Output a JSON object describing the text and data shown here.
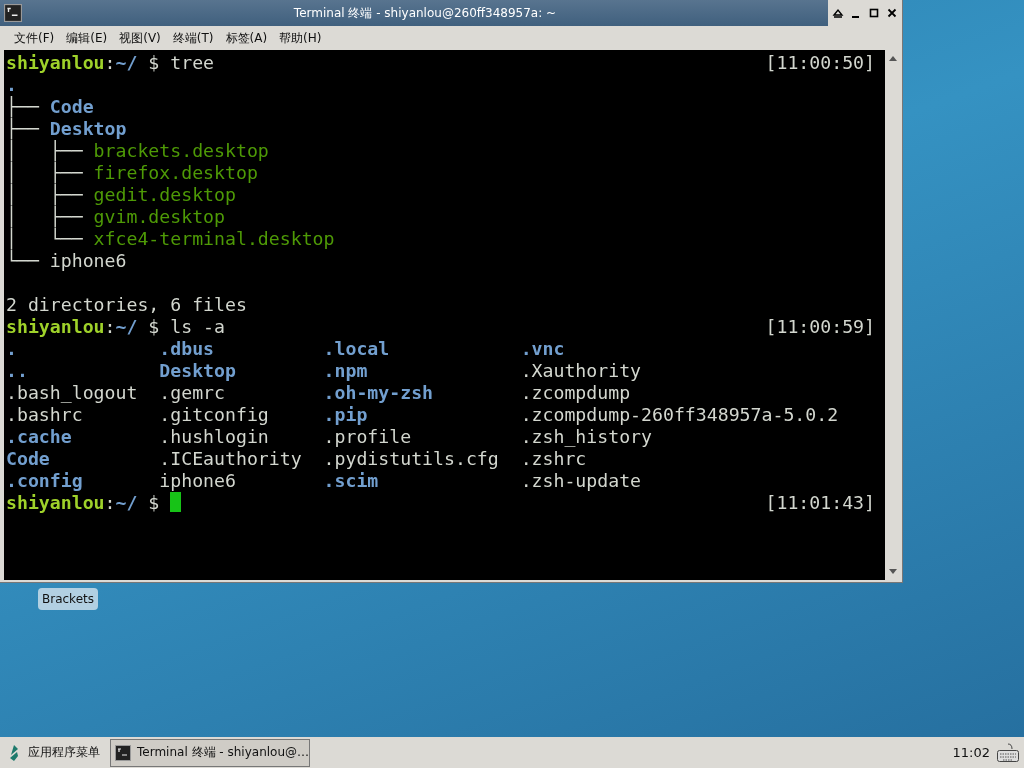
{
  "window": {
    "title": "Terminal 终端 - shiyanlou@260ff348957a: ~"
  },
  "menu": [
    "文件(F)",
    "编辑(E)",
    "视图(V)",
    "终端(T)",
    "标签(A)",
    "帮助(H)"
  ],
  "terminal": {
    "blocks": [
      {
        "kind": "line",
        "segments": [
          {
            "kind": "user",
            "text": "shiyanlou"
          },
          {
            "kind": "plain",
            "text": ":"
          },
          {
            "kind": "path",
            "text": "~/"
          },
          {
            "kind": "plain",
            "text": " $ tree"
          }
        ],
        "timestamp": "[11:00:50]"
      },
      {
        "kind": "line",
        "segments": [
          {
            "kind": "dir",
            "text": "."
          }
        ]
      },
      {
        "kind": "line",
        "segments": [
          {
            "kind": "plain",
            "text": "├── "
          },
          {
            "kind": "dir",
            "text": "Code"
          }
        ]
      },
      {
        "kind": "line",
        "segments": [
          {
            "kind": "plain",
            "text": "├── "
          },
          {
            "kind": "dir",
            "text": "Desktop"
          }
        ]
      },
      {
        "kind": "line",
        "segments": [
          {
            "kind": "plain",
            "text": "│   ├── "
          },
          {
            "kind": "exec",
            "text": "brackets.desktop"
          }
        ]
      },
      {
        "kind": "line",
        "segments": [
          {
            "kind": "plain",
            "text": "│   ├── "
          },
          {
            "kind": "exec",
            "text": "firefox.desktop"
          }
        ]
      },
      {
        "kind": "line",
        "segments": [
          {
            "kind": "plain",
            "text": "│   ├── "
          },
          {
            "kind": "exec",
            "text": "gedit.desktop"
          }
        ]
      },
      {
        "kind": "line",
        "segments": [
          {
            "kind": "plain",
            "text": "│   ├── "
          },
          {
            "kind": "exec",
            "text": "gvim.desktop"
          }
        ]
      },
      {
        "kind": "line",
        "segments": [
          {
            "kind": "plain",
            "text": "│   └── "
          },
          {
            "kind": "exec",
            "text": "xfce4-terminal.desktop"
          }
        ]
      },
      {
        "kind": "line",
        "segments": [
          {
            "kind": "plain",
            "text": "└── iphone6"
          }
        ]
      },
      {
        "kind": "blank"
      },
      {
        "kind": "line",
        "segments": [
          {
            "kind": "plain",
            "text": "2 directories, 6 files"
          }
        ]
      },
      {
        "kind": "line",
        "segments": [
          {
            "kind": "user",
            "text": "shiyanlou"
          },
          {
            "kind": "plain",
            "text": ":"
          },
          {
            "kind": "path",
            "text": "~/"
          },
          {
            "kind": "plain",
            "text": " $ ls -a"
          }
        ],
        "timestamp": "[11:00:59]"
      },
      {
        "kind": "listing",
        "rows": [
          [
            {
              "kind": "dir",
              "text": "."
            },
            {
              "kind": "dir",
              "text": ".dbus"
            },
            {
              "kind": "dir",
              "text": ".local"
            },
            {
              "kind": "dir",
              "text": ".vnc"
            }
          ],
          [
            {
              "kind": "dir",
              "text": ".."
            },
            {
              "kind": "dir",
              "text": "Desktop"
            },
            {
              "kind": "dir",
              "text": ".npm"
            },
            {
              "kind": "plain",
              "text": ".Xauthority"
            }
          ],
          [
            {
              "kind": "plain",
              "text": ".bash_logout"
            },
            {
              "kind": "plain",
              "text": ".gemrc"
            },
            {
              "kind": "dir",
              "text": ".oh-my-zsh"
            },
            {
              "kind": "plain",
              "text": ".zcompdump"
            }
          ],
          [
            {
              "kind": "plain",
              "text": ".bashrc"
            },
            {
              "kind": "plain",
              "text": ".gitconfig"
            },
            {
              "kind": "dir",
              "text": ".pip"
            },
            {
              "kind": "plain",
              "text": ".zcompdump-260ff348957a-5.0.2"
            }
          ],
          [
            {
              "kind": "dir",
              "text": ".cache"
            },
            {
              "kind": "plain",
              "text": ".hushlogin"
            },
            {
              "kind": "plain",
              "text": ".profile"
            },
            {
              "kind": "plain",
              "text": ".zsh_history"
            }
          ],
          [
            {
              "kind": "dir",
              "text": "Code"
            },
            {
              "kind": "plain",
              "text": ".ICEauthority"
            },
            {
              "kind": "plain",
              "text": ".pydistutils.cfg"
            },
            {
              "kind": "plain",
              "text": ".zshrc"
            }
          ],
          [
            {
              "kind": "dir",
              "text": ".config"
            },
            {
              "kind": "plain",
              "text": "iphone6"
            },
            {
              "kind": "dir",
              "text": ".scim"
            },
            {
              "kind": "plain",
              "text": ".zsh-update"
            }
          ]
        ]
      },
      {
        "kind": "line",
        "segments": [
          {
            "kind": "user",
            "text": "shiyanlou"
          },
          {
            "kind": "plain",
            "text": ":"
          },
          {
            "kind": "path",
            "text": "~/"
          },
          {
            "kind": "plain",
            "text": " $"
          }
        ],
        "timestamp": "[11:01:43]",
        "cursor": true
      }
    ]
  },
  "desktop": {
    "icons": [
      {
        "label": "Brackets"
      }
    ]
  },
  "taskbar": {
    "app_menu": "应用程序菜单",
    "tasks": [
      {
        "label": "Terminal 终端 - shiyanlou@…",
        "selected": true
      }
    ],
    "clock": "11:02"
  }
}
